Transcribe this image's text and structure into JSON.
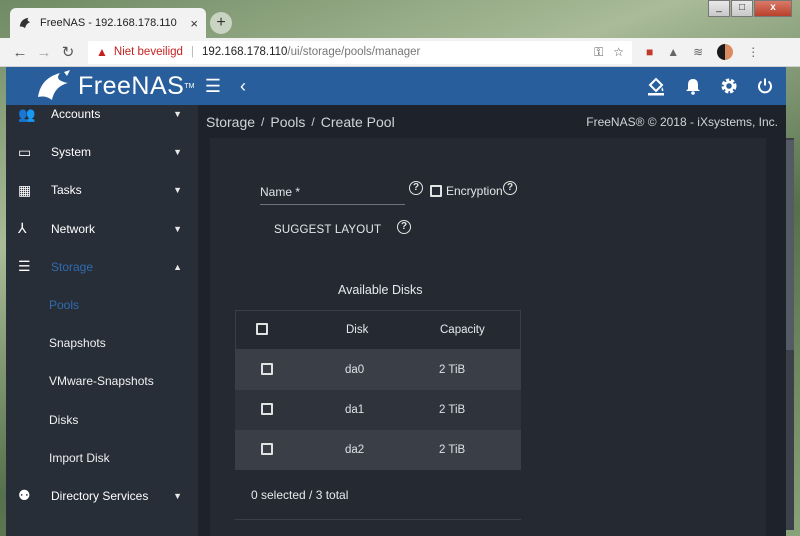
{
  "browser": {
    "tab_title": "FreeNAS - 192.168.178.110",
    "tab_close": "×",
    "new_tab": "+",
    "window_buttons": [
      "_",
      "□",
      "x"
    ],
    "security_label": "Niet beveiligd",
    "url_host": "192.168.178.110",
    "url_path": "/ui/storage/pools/manager"
  },
  "app": {
    "brand": "FreeNAS",
    "trademark": "TM"
  },
  "sidebar": {
    "items": [
      {
        "label": "Accounts",
        "icon": "accounts-icon"
      },
      {
        "label": "System",
        "icon": "system-icon"
      },
      {
        "label": "Tasks",
        "icon": "tasks-icon"
      },
      {
        "label": "Network",
        "icon": "network-icon"
      },
      {
        "label": "Storage",
        "icon": "storage-icon"
      }
    ],
    "storage_sub": [
      "Pools",
      "Snapshots",
      "VMware-Snapshots",
      "Disks",
      "Import Disk"
    ],
    "after": [
      {
        "label": "Directory Services",
        "icon": "directory-services-icon"
      }
    ]
  },
  "header": {
    "breadcrumb": [
      "Storage",
      "Pools",
      "Create Pool"
    ],
    "crumb_sep": "/",
    "copyright": "FreeNAS® © 2018 - iXsystems, Inc."
  },
  "form": {
    "name_label": "Name *",
    "encryption_label": "Encryption",
    "suggest_layout": "SUGGEST LAYOUT",
    "help_glyph": "?"
  },
  "disks": {
    "title": "Available Disks",
    "columns": [
      "Disk",
      "Capacity"
    ],
    "rows": [
      {
        "disk": "da0",
        "capacity": "2 TiB"
      },
      {
        "disk": "da1",
        "capacity": "2 TiB"
      },
      {
        "disk": "da2",
        "capacity": "2 TiB"
      }
    ],
    "footer": "0 selected / 3 total"
  },
  "colors": {
    "topnav": "#285e9b",
    "sidebar": "#282e38",
    "active": "#2f6cae",
    "content_bg": "#1e232b"
  }
}
